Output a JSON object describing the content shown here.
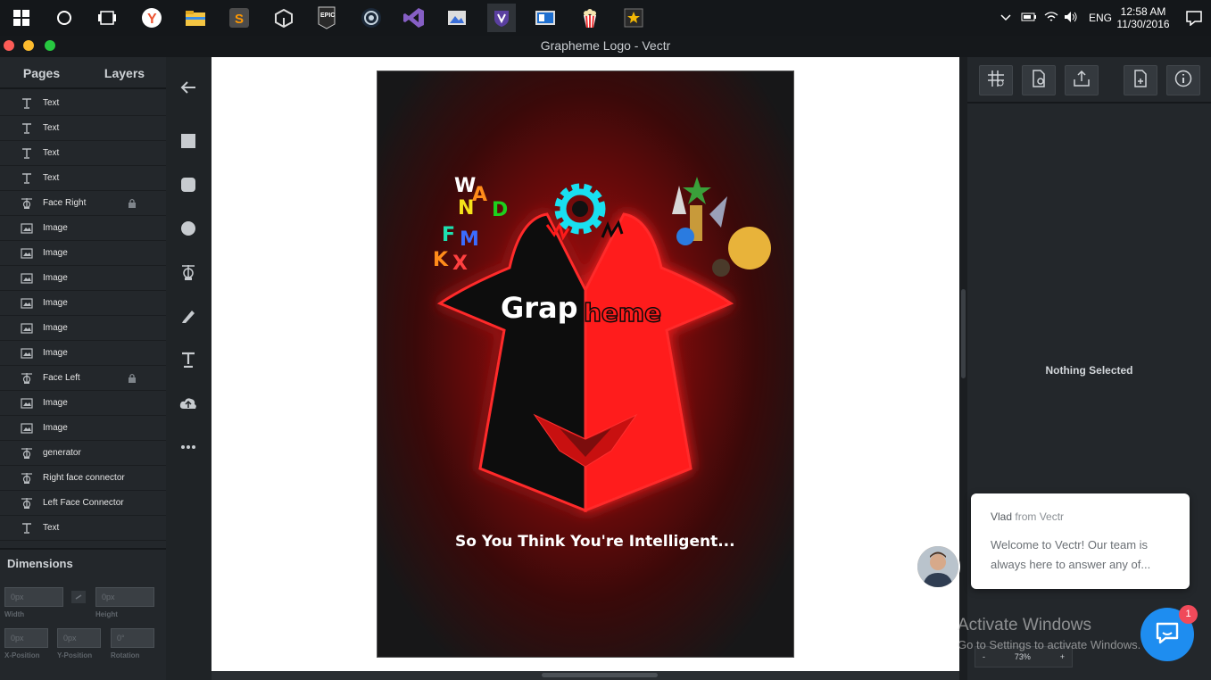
{
  "taskbar": {
    "apps": [
      "windows-start",
      "cortana",
      "task-view",
      "yandex-browser",
      "file-explorer",
      "sublime-text",
      "unity",
      "epic-games",
      "steam",
      "visual-studio",
      "photos",
      "vectr",
      "microsoft-store",
      "popcorn",
      "trophy-app"
    ],
    "tray": {
      "language": "ENG",
      "time": "12:58 AM",
      "date": "11/30/2016"
    }
  },
  "window": {
    "title": "Grapheme Logo - Vectr"
  },
  "left_panel": {
    "tabs": [
      "Pages",
      "Layers"
    ],
    "layers": [
      {
        "name": "Text",
        "type": "text",
        "locked": false
      },
      {
        "name": "Text",
        "type": "text",
        "locked": false
      },
      {
        "name": "Text",
        "type": "text",
        "locked": false
      },
      {
        "name": "Text",
        "type": "text",
        "locked": false
      },
      {
        "name": "Face Right",
        "type": "path",
        "locked": true
      },
      {
        "name": "Image",
        "type": "image",
        "locked": false
      },
      {
        "name": "Image",
        "type": "image",
        "locked": false
      },
      {
        "name": "Image",
        "type": "image",
        "locked": false
      },
      {
        "name": "Image",
        "type": "image",
        "locked": false
      },
      {
        "name": "Image",
        "type": "image",
        "locked": false
      },
      {
        "name": "Image",
        "type": "image",
        "locked": false
      },
      {
        "name": "Face Left",
        "type": "path",
        "locked": true
      },
      {
        "name": "Image",
        "type": "image",
        "locked": false
      },
      {
        "name": "Image",
        "type": "image",
        "locked": false
      },
      {
        "name": "generator",
        "type": "path",
        "locked": false
      },
      {
        "name": "Right face connector",
        "type": "path",
        "locked": false
      },
      {
        "name": "Left Face Connector",
        "type": "path",
        "locked": false
      },
      {
        "name": "Text",
        "type": "text",
        "locked": false
      }
    ],
    "dimensions": {
      "title": "Dimensions",
      "width": {
        "label": "Width",
        "value": "0px"
      },
      "height": {
        "label": "Height",
        "value": "0px"
      },
      "x": {
        "label": "X-Position",
        "value": "0px"
      },
      "y": {
        "label": "Y-Position",
        "value": "0px"
      },
      "rotation": {
        "label": "Rotation",
        "value": "0°"
      }
    }
  },
  "toolbar": {
    "tools": [
      "back-arrow",
      "rectangle",
      "rounded-rectangle",
      "ellipse",
      "path",
      "pen",
      "text",
      "upload",
      "more"
    ]
  },
  "artboard": {
    "logo_text_left": "Grap",
    "logo_text_right": "heme",
    "tagline": "So You Think You're Intelligent...",
    "colors": {
      "red": "#ff1a1a",
      "black": "#0a0a0a",
      "gear": "#19e0f0"
    }
  },
  "right_panel": {
    "buttons": [
      "grid-settings",
      "page-settings",
      "export",
      "add-page",
      "info"
    ],
    "status": "Nothing Selected",
    "zoom": {
      "minus": "-",
      "value": "73%",
      "plus": "+"
    }
  },
  "chat": {
    "sender": "Vlad",
    "from": "from Vectr",
    "message": "Welcome to Vectr!  Our team is always here to answer any of...",
    "badge": "1"
  },
  "watermark": {
    "line1": "Activate Windows",
    "line2": "Go to Settings to activate Windows."
  }
}
